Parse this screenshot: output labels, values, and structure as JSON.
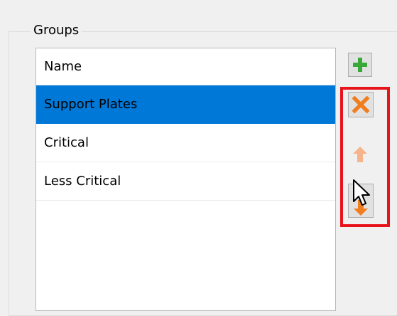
{
  "group": {
    "title": "Groups"
  },
  "list": {
    "header": "Name",
    "items": [
      {
        "label": "Support Plates",
        "selected": true
      },
      {
        "label": "Critical",
        "selected": false
      },
      {
        "label": "Less Critical",
        "selected": false
      }
    ]
  },
  "toolbar": {
    "add": {
      "icon": "plus-icon",
      "color": "#3aa93a",
      "enabled": true
    },
    "remove": {
      "icon": "x-icon",
      "color": "#f07d1e",
      "enabled": true
    },
    "move_up": {
      "icon": "arrow-up-icon",
      "color": "#f6b48a",
      "enabled": false
    },
    "move_down": {
      "icon": "arrow-down-icon",
      "color": "#f07d1e",
      "enabled": true
    }
  },
  "annotation": {
    "highlight_color": "#e8141c"
  },
  "colors": {
    "selection": "#0078d7"
  }
}
